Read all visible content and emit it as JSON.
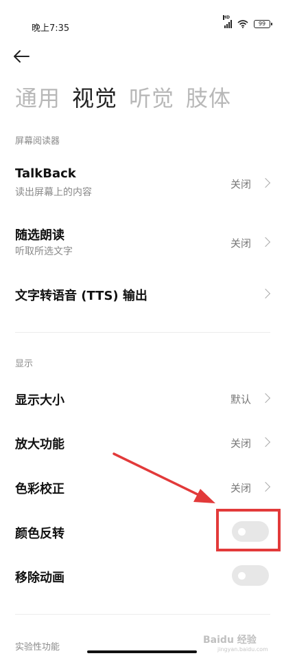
{
  "status_bar": {
    "time": "晚上7:35",
    "network_badge": "HD",
    "battery": "99",
    "icons": [
      "signal-icon",
      "wifi-icon",
      "battery-icon"
    ]
  },
  "header": {
    "back_icon": "arrow-left-icon",
    "tabs": [
      {
        "label": "通用",
        "active": false
      },
      {
        "label": "视觉",
        "active": true
      },
      {
        "label": "听觉",
        "active": false
      },
      {
        "label": "肢体",
        "active": false
      }
    ]
  },
  "sections": {
    "screen_reader": {
      "header": "屏幕阅读器",
      "items": [
        {
          "title": "TalkBack",
          "subtitle": "读出屏幕上的内容",
          "value": "关闭"
        },
        {
          "title": "随选朗读",
          "subtitle": "听取所选文字",
          "value": "关闭"
        },
        {
          "title": "文字转语音 (TTS) 输出",
          "subtitle": "",
          "value": ""
        }
      ]
    },
    "display": {
      "header": "显示",
      "items": [
        {
          "title": "显示大小",
          "value": "默认"
        },
        {
          "title": "放大功能",
          "value": "关闭"
        },
        {
          "title": "色彩校正",
          "value": "关闭"
        },
        {
          "title": "颜色反转",
          "toggle_on": false
        },
        {
          "title": "移除动画",
          "toggle_on": false
        }
      ]
    },
    "experimental": {
      "header": "实验性功能"
    }
  },
  "watermark": {
    "text": "Baidu 经验",
    "sub": "jingyan.baidu.com"
  },
  "colors": {
    "annotation_red": "#e23a3a",
    "toggle_off": "#e7e7e7",
    "inactive_tab": "#b8b8b8"
  }
}
